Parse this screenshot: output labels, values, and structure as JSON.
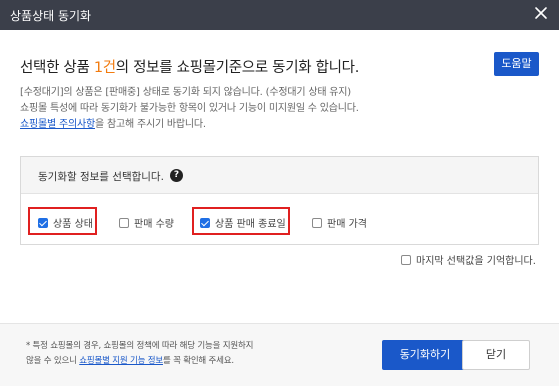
{
  "window": {
    "title": "상품상태 동기화",
    "close_icon": "close-icon"
  },
  "headline": {
    "prefix": "선택한 상품 ",
    "count": "1건",
    "suffix": "의 정보를 쇼핑몰기준으로 동기화 합니다.",
    "count_color": "#f27b0f"
  },
  "help_button": {
    "label": "도움말"
  },
  "notes": {
    "line1": "[수정대기]의 상품은 [판매중] 상태로 동기화 되지 않습니다. (수정대기 상태 유지)",
    "line2": "쇼핑몰 특성에 따라 동기화가 불가능한 항목이 있거나 기능이 미지원일 수 있습니다.",
    "link": "쇼핑몰별 주의사항",
    "line3_suffix": "을 참고해 주시기 바랍니다."
  },
  "section": {
    "header": "동기화할 정보를 선택합니다.",
    "help_icon": "question-circle-icon",
    "options": [
      {
        "label": "상품 상태",
        "checked": true
      },
      {
        "label": "판매 수량",
        "checked": false
      },
      {
        "label": "상품 판매 종료일",
        "checked": true
      },
      {
        "label": "판매 가격",
        "checked": false
      }
    ]
  },
  "remember": {
    "label": "마지막 선택값을 기억합니다.",
    "checked": false
  },
  "footer": {
    "note_line1": "* 특정 쇼핑몰의 경우, 쇼핑몰의 정책에 따라 해당 기능을 지원하지",
    "note_line2_prefix": "않을 수 있으니 ",
    "note_link": "쇼핑몰별 지원 기능 정보",
    "note_line2_suffix": "를 꼭 확인해 주세요.",
    "sync_button": "동기화하기",
    "close_button": "닫기"
  },
  "colors": {
    "titlebar": "#3b3f4a",
    "primary": "#1a58c9",
    "highlight_box": "#e02020",
    "checkbox_on": "#1f6fe5"
  }
}
